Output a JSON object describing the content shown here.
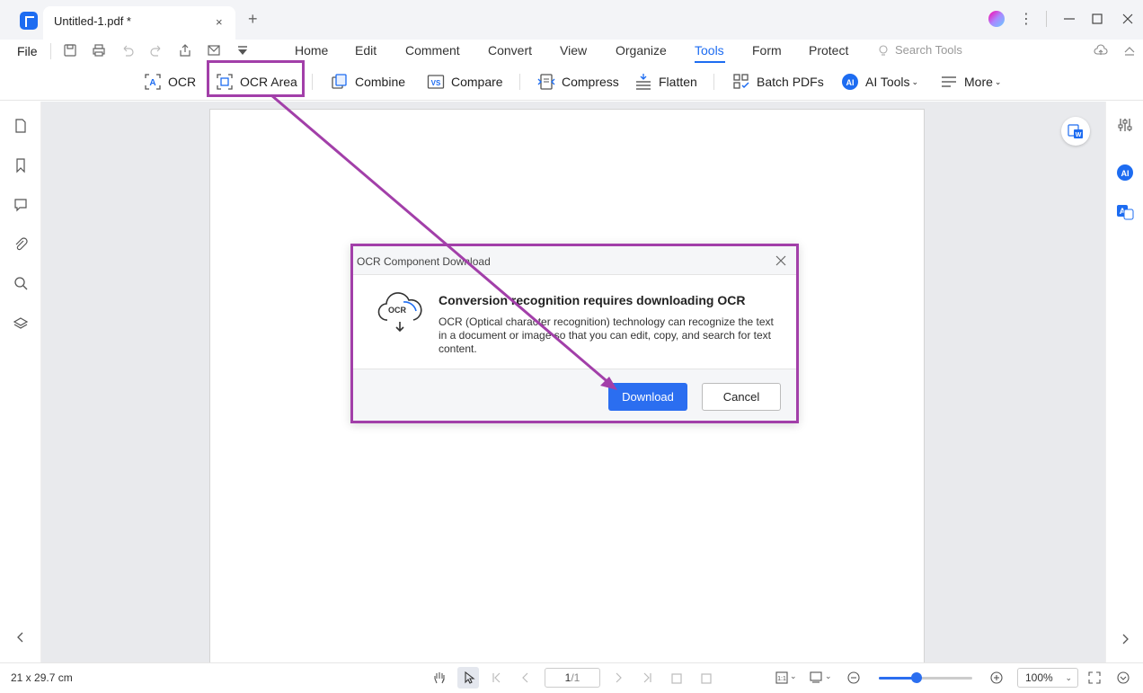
{
  "titlebar": {
    "tab_title": "Untitled-1.pdf *",
    "tab_close": "×",
    "new_tab": "+"
  },
  "menubar": {
    "file": "File",
    "nav": [
      "Home",
      "Edit",
      "Comment",
      "Convert",
      "View",
      "Organize",
      "Tools",
      "Form",
      "Protect"
    ],
    "active_nav": "Tools",
    "search_placeholder": "Search Tools"
  },
  "toolbar": {
    "ocr": "OCR",
    "ocr_area": "OCR Area",
    "combine": "Combine",
    "compare": "Compare",
    "compress": "Compress",
    "flatten": "Flatten",
    "batch_pdfs": "Batch PDFs",
    "ai_tools": "AI Tools",
    "more": "More"
  },
  "dialog": {
    "title": "OCR Component Download",
    "heading": "Conversion recognition requires downloading OCR",
    "description": "OCR (Optical character recognition) technology can recognize the text in a document or image so that you can edit, copy, and search for text content.",
    "icon_label": "OCR",
    "download_label": "Download",
    "cancel_label": "Cancel"
  },
  "statusbar": {
    "page_size": "21 x 29.7 cm",
    "current_page": "1",
    "total_pages": "/1",
    "zoom": "100%",
    "zoom_fraction": 0.4
  },
  "colors": {
    "accent": "#1d6cf1",
    "annotation": "#a23fa9"
  }
}
